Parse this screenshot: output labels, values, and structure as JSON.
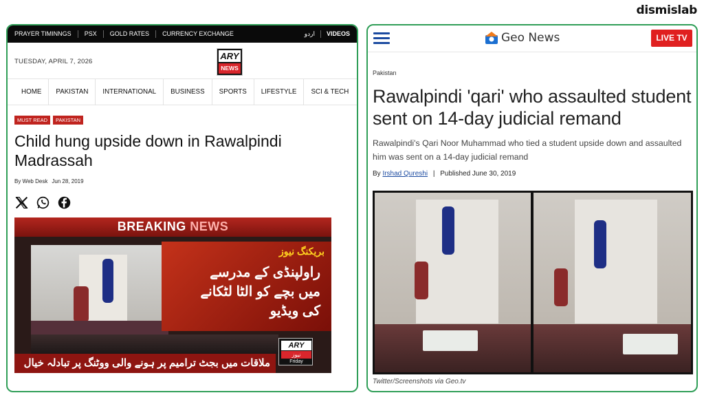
{
  "brand": "dismislab",
  "ary": {
    "top_links": [
      "PRAYER TIMINNGS",
      "PSX",
      "GOLD RATES",
      "CURRENCY EXCHANGE"
    ],
    "urdu_link": "اردو",
    "videos_link": "VIDEOS",
    "date": "TUESDAY, APRIL 7, 2026",
    "logo_top": "ARY",
    "logo_bottom": "NEWS",
    "nav": [
      "HOME",
      "PAKISTAN",
      "INTERNATIONAL",
      "BUSINESS",
      "SPORTS",
      "LIFESTYLE",
      "SCI & TECH"
    ],
    "tags": [
      "MUST READ",
      "PAKISTAN"
    ],
    "title": "Child hung upside down in Rawalpindi Madrassah",
    "byline": "By Web Desk",
    "date_pub": "Jun 28, 2019",
    "social_icons": [
      "x-icon",
      "whatsapp-icon",
      "facebook-icon"
    ],
    "video": {
      "breaking": "BREAKING",
      "news": "NEWS",
      "urdu_title": "بریکنگ نیوز",
      "urdu_lines": [
        "راولپنڈی کے مدرسے",
        "میں بچے کو الٹا لٹکانے",
        "کی ویڈیو"
      ],
      "ticker": "ملاقات میں بجٹ ترامیم پر ہونے والی ووٹنگ پر تبادلہ خیال",
      "mini_logo_top": "ARY",
      "mini_logo_mid": "نیوز",
      "mini_logo_bottom": "Friday"
    }
  },
  "geo": {
    "logo_text": "Geo News",
    "live_label": "LIVE TV",
    "kicker": "Pakistan",
    "title": "Rawalpindi 'qari' who assaulted student sent on 14-day judicial remand",
    "subtitle": "Rawalpindi's Qari Noor Muhammad who tied a student upside down and assaulted him was sent on a 14-day judicial remand",
    "by": "By",
    "author": "Irshad Qureshi",
    "published": "Published June 30, 2019",
    "caption": "Twitter/Screenshots via Geo.tv"
  },
  "colors": {
    "frame": "#2f9e57",
    "ary_red": "#c0241f",
    "geo_blue": "#1b4aa0",
    "live_red": "#e02020"
  }
}
